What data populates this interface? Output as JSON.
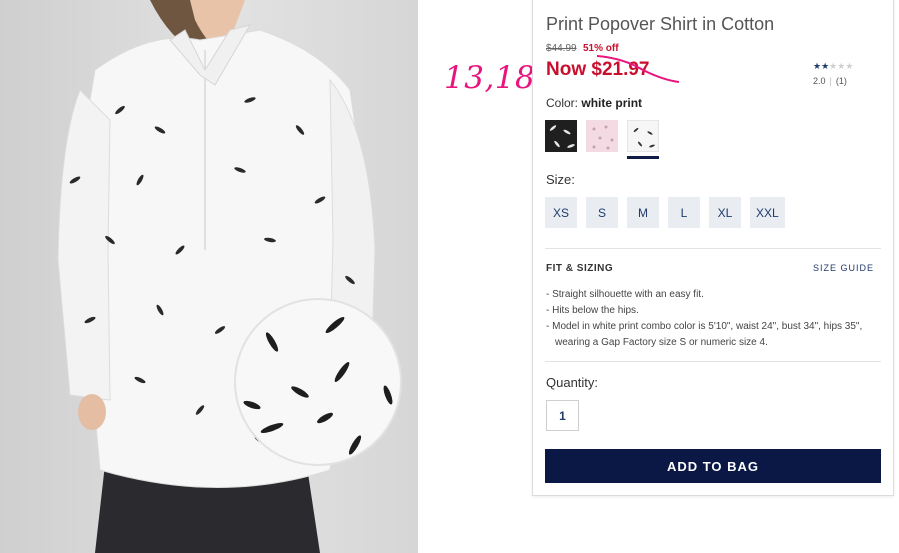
{
  "product": {
    "title": "Print Popover Shirt in Cotton",
    "was_price": "$44.99",
    "discount": "51% off",
    "now_price": "Now $21.97"
  },
  "annotation": {
    "note": "13,18",
    "color": "#e8157f"
  },
  "rating": {
    "score": "2.0",
    "count": "(1)",
    "stars_filled": 2,
    "stars_total": 5
  },
  "color": {
    "label": "Color:",
    "selected": "white print",
    "swatches": [
      {
        "name": "black print",
        "hex": "#1f1f1f"
      },
      {
        "name": "pink print",
        "hex": "#f4dbe3"
      },
      {
        "name": "white print",
        "hex": "#f6f6f6",
        "selected": true
      }
    ]
  },
  "size": {
    "label": "Size:",
    "options": [
      "XS",
      "S",
      "M",
      "L",
      "XL",
      "XXL"
    ]
  },
  "fit": {
    "title": "FIT & SIZING",
    "guide_link": "SIZE GUIDE",
    "bullets": [
      "- Straight silhouette with an easy fit.",
      "- Hits below the hips.",
      "- Model in white print combo color is 5'10\", waist 24\", bust 34\", hips 35\", wearing a Gap Factory size S or numeric size 4."
    ]
  },
  "quantity": {
    "label": "Quantity:",
    "value": "1"
  },
  "cta": {
    "add_to_bag": "ADD TO BAG"
  },
  "colors": {
    "sale_red": "#c8102e",
    "navy": "#0b1846",
    "link_blue": "#1f3a6b"
  }
}
